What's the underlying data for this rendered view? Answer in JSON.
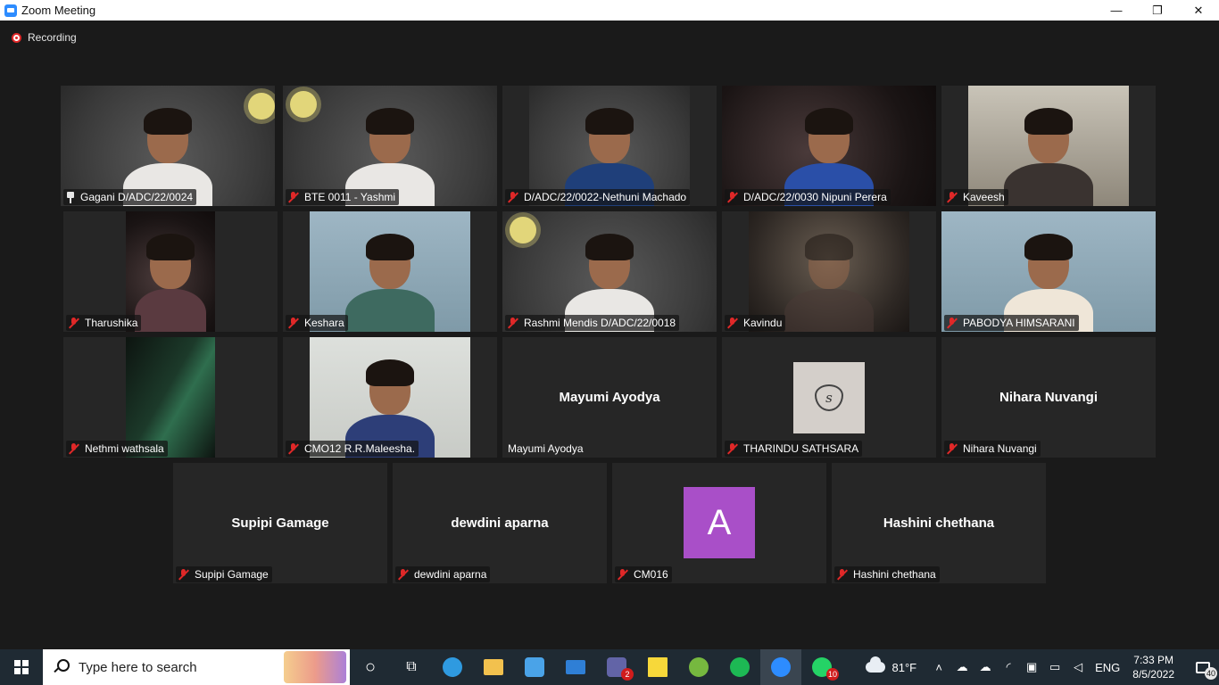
{
  "window": {
    "title": "Zoom Meeting",
    "controls": {
      "minimize": "—",
      "maximize": "❐",
      "close": "✕"
    }
  },
  "meeting": {
    "recording_label": "Recording",
    "tiles": [
      {
        "name": "Gagani D/ADC/22/0024",
        "icon": "pin-icon",
        "video": "chalk"
      },
      {
        "name": "BTE 0011 - Yashmi",
        "icon": "mic-muted-icon",
        "video": "chalk"
      },
      {
        "name": "D/ADC/22/0022-Nethuni Machado",
        "icon": "mic-muted-icon",
        "video": "chalk"
      },
      {
        "name": "D/ADC/22/0030 Nipuni Perera",
        "icon": "mic-muted-icon",
        "video": "dark"
      },
      {
        "name": "Kaveesh",
        "icon": "mic-muted-icon",
        "video": "room"
      },
      {
        "name": "Tharushika",
        "icon": "mic-muted-icon",
        "video": "dark"
      },
      {
        "name": "Keshara",
        "icon": "mic-muted-icon",
        "video": "bluewall"
      },
      {
        "name": "Rashmi Mendis D/ADC/22/0018",
        "icon": "mic-muted-icon",
        "video": "chalk"
      },
      {
        "name": "Kavindu",
        "icon": "mic-muted-icon",
        "video": "dim"
      },
      {
        "name": "PABODYA HIMSARANI",
        "icon": "mic-muted-icon",
        "video": "bluewall"
      },
      {
        "name": "Nethmi wathsala",
        "icon": "mic-muted-icon",
        "video": "green"
      },
      {
        "name": "CMO12 R.R.Maleesha.",
        "icon": "mic-muted-icon",
        "video": "bright"
      },
      {
        "name": "Mayumi Ayodya",
        "center_name": "Mayumi Ayodya",
        "icon": "none"
      },
      {
        "name": "THARINDU SATHSARA",
        "icon": "mic-muted-icon",
        "avatar_letter": "s"
      },
      {
        "name": "Nihara Nuvangi",
        "center_name": "Nihara Nuvangi",
        "icon": "mic-muted-icon"
      },
      {
        "name": "Supipi Gamage",
        "center_name": "Supipi Gamage",
        "icon": "mic-muted-icon"
      },
      {
        "name": "dewdini aparna",
        "center_name": "dewdini aparna",
        "icon": "mic-muted-icon"
      },
      {
        "name": "CM016",
        "avatar_letter": "A",
        "avatar_color": "#a94fc8",
        "icon": "mic-muted-icon"
      },
      {
        "name": "Hashini chethana",
        "center_name": "Hashini chethana",
        "icon": "mic-muted-icon"
      }
    ],
    "colors": {
      "active_speaker_border": "#e4ee5b",
      "muted_mic": "#e02828",
      "background": "#1a1a1a"
    }
  },
  "taskbar": {
    "search_placeholder": "Type here to search",
    "apps": [
      {
        "name": "cortana-icon",
        "glyph": "○"
      },
      {
        "name": "task-view-icon",
        "glyph": "⧉"
      },
      {
        "name": "edge-icon",
        "color": "#2f9ae0"
      },
      {
        "name": "file-explorer-icon",
        "color": "#f2c14e"
      },
      {
        "name": "store-icon",
        "color": "#4aa3e8"
      },
      {
        "name": "mail-icon",
        "color": "#2f7fd6"
      },
      {
        "name": "teams-icon",
        "color": "#6264a7",
        "badge": "2"
      },
      {
        "name": "sticky-notes-icon",
        "color": "#f7d83a"
      },
      {
        "name": "utorrent-icon",
        "color": "#76b83f"
      },
      {
        "name": "spotify-icon",
        "color": "#1db954"
      },
      {
        "name": "zoom-icon",
        "color": "#2d8cff",
        "active": true
      },
      {
        "name": "whatsapp-icon",
        "color": "#25d366",
        "badge": "10"
      }
    ],
    "tray": {
      "temperature": "81°F",
      "language": "ENG",
      "time": "7:33 PM",
      "date": "8/5/2022",
      "notification_count": "40"
    }
  }
}
